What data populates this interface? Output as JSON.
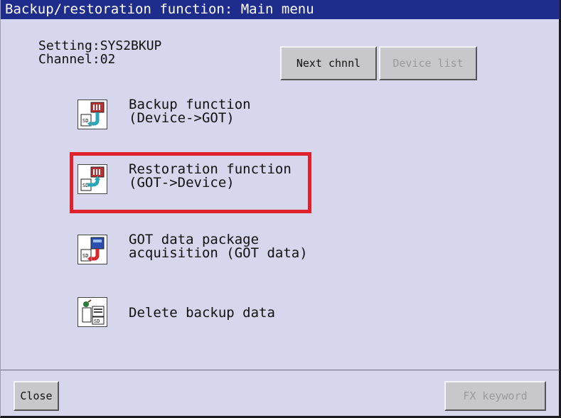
{
  "window": {
    "title": "Backup/restoration function: Main menu"
  },
  "info": {
    "setting": "Setting:SYS2BKUP",
    "channel": "Channel:02"
  },
  "top_buttons": {
    "next_channel": "Next chnnl",
    "device_list": "Device list"
  },
  "menu": [
    {
      "line1": "Backup function",
      "line2": "(Device->GOT)",
      "icon": "backup-icon",
      "selected": false
    },
    {
      "line1": "Restoration function",
      "line2": "(GOT->Device)",
      "icon": "restore-icon",
      "selected": true
    },
    {
      "line1": "GOT data package",
      "line2": "acquisition (GOT data)",
      "icon": "package-acquisition-icon",
      "selected": false
    },
    {
      "line1": "Delete backup data",
      "line2": "",
      "icon": "delete-data-icon",
      "selected": false
    }
  ],
  "bottom_buttons": {
    "close": "Close",
    "fx_keyword": "FX keyword"
  },
  "colors": {
    "title_bar": "#1e2d8c",
    "background": "#d6d6ec",
    "highlight": "#e0202a"
  }
}
